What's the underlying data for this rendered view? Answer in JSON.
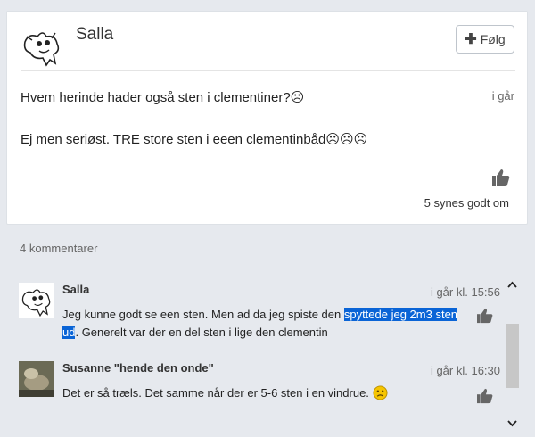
{
  "post": {
    "author": "Salla",
    "follow_label": "Følg",
    "title": "Hvem herinde hader også sten i clementiner?☹",
    "time": "i går",
    "body": "Ej men seriøst. TRE store sten i eeen clementinbåd☹☹☹",
    "likes": "5 synes godt om"
  },
  "comments_count": "4 kommentarer",
  "comments": [
    {
      "author": "Salla",
      "time": "i går kl. 15:56",
      "text_before": "Jeg kunne godt se een sten. Men ad da jeg spiste den ",
      "text_selected": "spyttede jeg 2m3 sten ud",
      "text_after": ". Generelt var der en del sten i lige den clementin"
    },
    {
      "author": "Susanne \"hende den onde\"",
      "time": "i går kl. 16:30",
      "text": "Det er så træls. Det samme når der er 5-6 sten i en vindrue. "
    }
  ],
  "icons": {
    "like": "thumbs-up-icon",
    "follow": "plus-icon",
    "sad_emoji": "frowning-face-icon",
    "scroll_up": "chevron-up-icon",
    "scroll_down": "chevron-down-icon"
  },
  "colors": {
    "background": "#e6e9ee",
    "selection": "#0a64d6",
    "emoji": "#f6c500"
  }
}
